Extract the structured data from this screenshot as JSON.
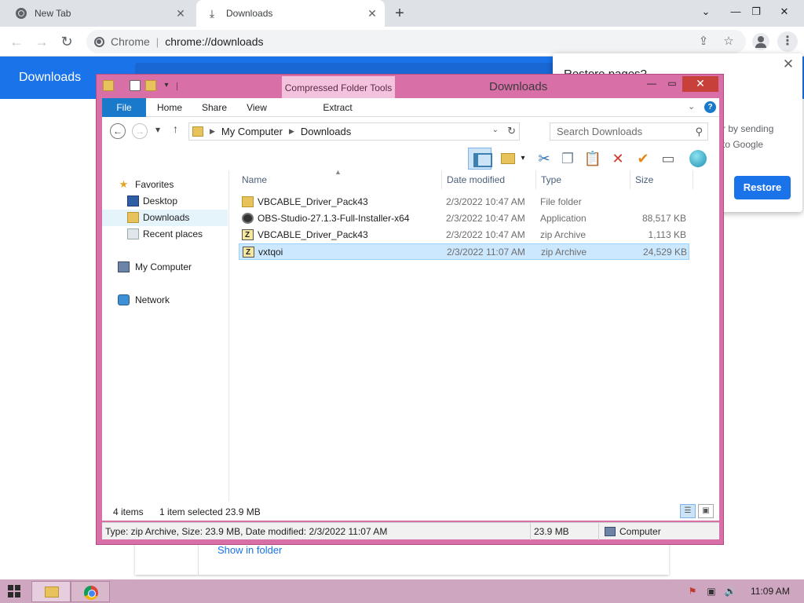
{
  "browser": {
    "tabs": [
      {
        "label": "New Tab",
        "icon": "chrome-icon"
      },
      {
        "label": "Downloads",
        "icon": "download-icon",
        "active": true
      }
    ],
    "new_tab_glyph": "+",
    "site_name": "Chrome",
    "url": "chrome://downloads",
    "window_controls": {
      "minimize": "—",
      "restore": "❐",
      "close": "✕"
    },
    "tab_list_glyph": "⌄"
  },
  "downloads_page": {
    "title": "Downloads",
    "show_in_folder": "Show in folder"
  },
  "restore_popup": {
    "title": "Restore pages?",
    "text_line1": "r by sending",
    "text_line2": "to Google",
    "button": "Restore",
    "close_glyph": "✕"
  },
  "explorer": {
    "title": "Downloads",
    "contextual_tab": "Compressed Folder Tools",
    "ribbon_tabs": [
      "File",
      "Home",
      "Share",
      "View",
      "Extract"
    ],
    "help_glyph": "?",
    "breadcrumb": [
      "My Computer",
      "Downloads"
    ],
    "search_placeholder": "Search Downloads",
    "columns": {
      "name": "Name",
      "date": "Date modified",
      "type": "Type",
      "size": "Size"
    },
    "nav": {
      "favorites": "Favorites",
      "desktop": "Desktop",
      "downloads": "Downloads",
      "recent": "Recent places",
      "computer": "My Computer",
      "network": "Network"
    },
    "files": [
      {
        "name": "VBCABLE_Driver_Pack43",
        "date": "2/3/2022 10:47 AM",
        "type": "File folder",
        "size": "",
        "icon": "folder-icon"
      },
      {
        "name": "OBS-Studio-27.1.3-Full-Installer-x64",
        "date": "2/3/2022 10:47 AM",
        "type": "Application",
        "size": "88,517 KB",
        "icon": "app-icon"
      },
      {
        "name": "VBCABLE_Driver_Pack43",
        "date": "2/3/2022 10:47 AM",
        "type": "zip Archive",
        "size": "1,113 KB",
        "icon": "zip-icon"
      },
      {
        "name": "vxtqoi",
        "date": "2/3/2022 11:07 AM",
        "type": "zip Archive",
        "size": "24,529 KB",
        "icon": "zip-icon",
        "selected": true
      }
    ],
    "status": {
      "count": "4 items",
      "selection": "1 item selected  23.9 MB"
    },
    "details": {
      "info": "Type: zip Archive, Size: 23.9 MB, Date modified: 2/3/2022 11:07 AM",
      "size": "23.9 MB",
      "location": "Computer"
    }
  },
  "taskbar": {
    "time": "11:09 AM"
  },
  "colors": {
    "chrome_blue": "#1a73e8",
    "explorer_frame": "#d86fa7",
    "taskbar": "#cfa6c0",
    "selection": "#cce8ff"
  }
}
